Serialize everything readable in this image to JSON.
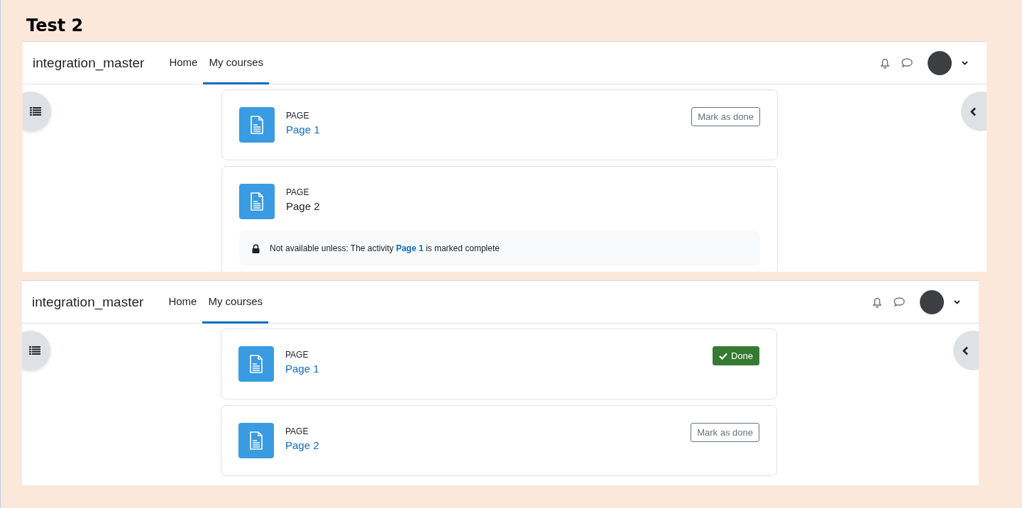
{
  "heading": "Test 2",
  "panels": [
    {
      "site_name": "integration_master",
      "nav": [
        {
          "label": "Home",
          "selected": false
        },
        {
          "label": "My courses",
          "selected": true
        }
      ],
      "activities": [
        {
          "type_label": "PAGE",
          "name": "Page 1",
          "linked": true,
          "completion": {
            "done": false,
            "label": "Mark as done"
          }
        },
        {
          "type_label": "PAGE",
          "name": "Page 2",
          "linked": false,
          "restriction": {
            "before": "Not available unless: The activity ",
            "link": "Page 1",
            "after": " is marked complete"
          }
        }
      ]
    },
    {
      "site_name": "integration_master",
      "nav": [
        {
          "label": "Home",
          "selected": false
        },
        {
          "label": "My courses",
          "selected": true
        }
      ],
      "activities": [
        {
          "type_label": "PAGE",
          "name": "Page 1",
          "linked": true,
          "completion": {
            "done": true,
            "label": "Done"
          }
        },
        {
          "type_label": "PAGE",
          "name": "Page 2",
          "linked": true,
          "completion": {
            "done": false,
            "label": "Mark as done"
          }
        }
      ]
    }
  ]
}
